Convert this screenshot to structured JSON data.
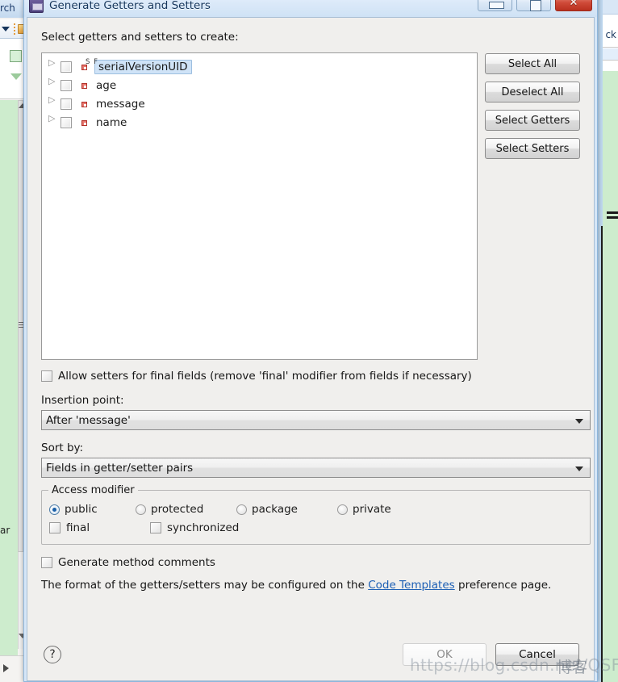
{
  "window": {
    "title": "Generate Getters and Setters",
    "icon": "eclipse-dialog-icon",
    "controls": {
      "minimize": "minimize-button",
      "maximize": "maximize-button",
      "close": "✕"
    }
  },
  "background": {
    "left_tab_label": "rch",
    "left_editor_text": "ar",
    "right_tab_label": "ck"
  },
  "dialog": {
    "prompt": "Select getters and setters to create:",
    "tree": {
      "items": [
        {
          "label": "serialVersionUID",
          "checked": false,
          "selected": true,
          "icon": "private-static-final-field-icon",
          "modifiers": "S F"
        },
        {
          "label": "age",
          "checked": false,
          "selected": false,
          "icon": "private-field-icon",
          "modifiers": ""
        },
        {
          "label": "message",
          "checked": false,
          "selected": false,
          "icon": "private-field-icon",
          "modifiers": ""
        },
        {
          "label": "name",
          "checked": false,
          "selected": false,
          "icon": "private-field-icon",
          "modifiers": ""
        }
      ]
    },
    "side_buttons": [
      {
        "label": "Select All"
      },
      {
        "label": "Deselect All"
      },
      {
        "label": "Select Getters"
      },
      {
        "label": "Select Setters"
      }
    ],
    "allow_setters": {
      "label": "Allow setters for final fields (remove 'final' modifier from fields if necessary)",
      "checked": false
    },
    "insertion_point": {
      "label": "Insertion point:",
      "value": "After 'message'"
    },
    "sort_by": {
      "label": "Sort by:",
      "value": "Fields in getter/setter pairs"
    },
    "access_modifier": {
      "title": "Access modifier",
      "radios": [
        {
          "label": "public",
          "selected": true
        },
        {
          "label": "protected",
          "selected": false
        },
        {
          "label": "package",
          "selected": false
        },
        {
          "label": "private",
          "selected": false
        }
      ],
      "checkboxes": [
        {
          "label": "final",
          "checked": false
        },
        {
          "label": "synchronized",
          "checked": false
        }
      ]
    },
    "generate_comments": {
      "label": "Generate method comments",
      "checked": false
    },
    "note": {
      "prefix": "The format of the getters/setters may be configured on the ",
      "link": "Code Templates",
      "suffix": " preference page."
    },
    "footer": {
      "help": "?",
      "ok": "OK",
      "cancel": "Cancel"
    }
  },
  "watermark": {
    "url": "https://blog.csdn.net/QSFTQ",
    "suffix": "博客"
  }
}
